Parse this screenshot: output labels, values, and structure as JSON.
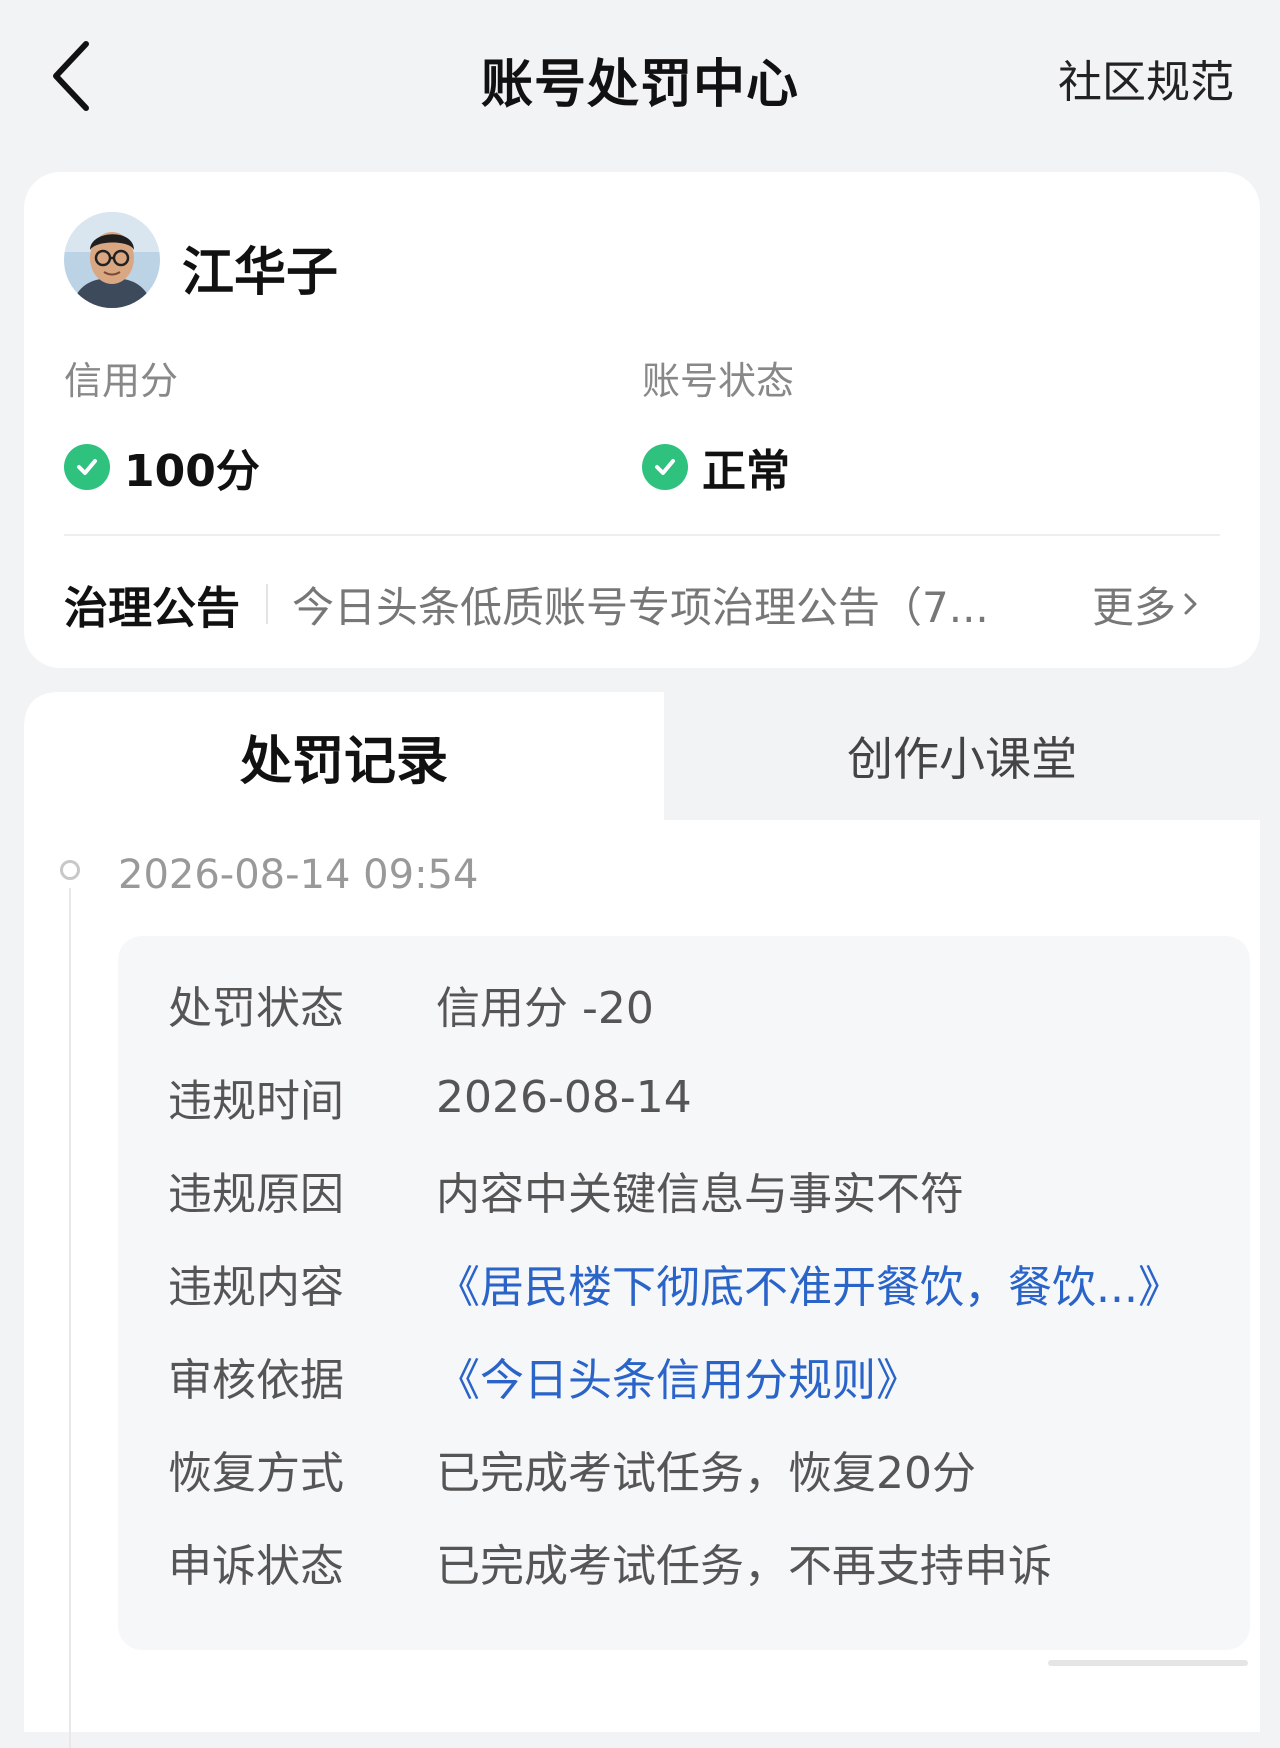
{
  "header": {
    "title": "账号处罚中心",
    "right_link": "社区规范",
    "back_icon": "chevron-left-icon"
  },
  "profile": {
    "username": "江华子",
    "credit_label": "信用分",
    "credit_value": "100分",
    "status_label": "账号状态",
    "status_value": "正常",
    "status_color": "#2ec27e"
  },
  "notice": {
    "label": "治理公告",
    "text": "今日头条低质账号专项治理公告（7...",
    "more": "更多"
  },
  "tabs": [
    {
      "label": "处罚记录",
      "active": true
    },
    {
      "label": "创作小课堂",
      "active": false
    }
  ],
  "record": {
    "timestamp": "2026-08-14 09:54",
    "rows": [
      {
        "key": "处罚状态",
        "value": "信用分 -20"
      },
      {
        "key": "违规时间",
        "value": "2026-08-14"
      },
      {
        "key": "违规原因",
        "value": "内容中关键信息与事实不符"
      },
      {
        "key": "违规内容",
        "value": "《居民楼下彻底不准开餐饮，餐饮...》"
      },
      {
        "key": "审核依据",
        "value": "《今日头条信用分规则》"
      },
      {
        "key": "恢复方式",
        "value": "已完成考试任务，恢复20分"
      },
      {
        "key": "申诉状态",
        "value": "已完成考试任务，不再支持申诉"
      }
    ]
  },
  "colors": {
    "link": "#2a64c8",
    "background": "#f2f3f5"
  }
}
